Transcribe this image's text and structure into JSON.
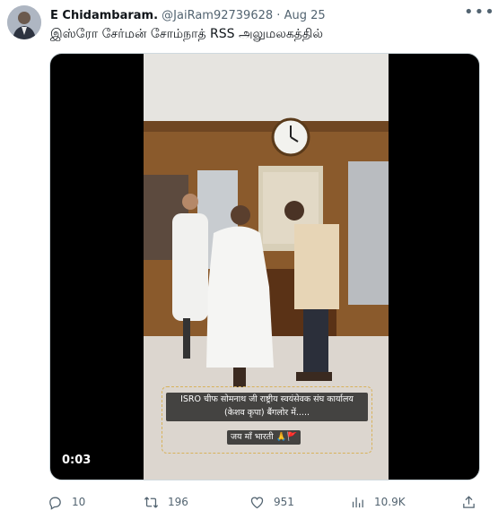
{
  "tweet": {
    "author_name": "E Chidambaram.",
    "handle": "@JaiRam92739628",
    "separator": "·",
    "date": "Aug 25",
    "text": "இஸ்ரோ சேர்மன் சோம்நாத் RSS அலுமலகத்தில்",
    "more_label": "•••"
  },
  "video": {
    "timestamp": "0:03",
    "caption_line1": "ISRO चीफ सोमनाथ जी राष्ट्रीय स्वयंसेवक संघ कार्यालय",
    "caption_line2": "(केशव कृपा) बैंगलोर में.....",
    "caption_line3": "जय माँ भारती 🙏🚩"
  },
  "actions": {
    "replies": "10",
    "retweets": "196",
    "likes": "951",
    "views": "10.9K"
  },
  "icons": [
    "more-icon",
    "reply-icon",
    "retweet-icon",
    "like-icon",
    "views-icon",
    "share-icon"
  ],
  "colors": {
    "text": "#0f1419",
    "muted": "#536471",
    "caption_border": "#d8b25a"
  }
}
